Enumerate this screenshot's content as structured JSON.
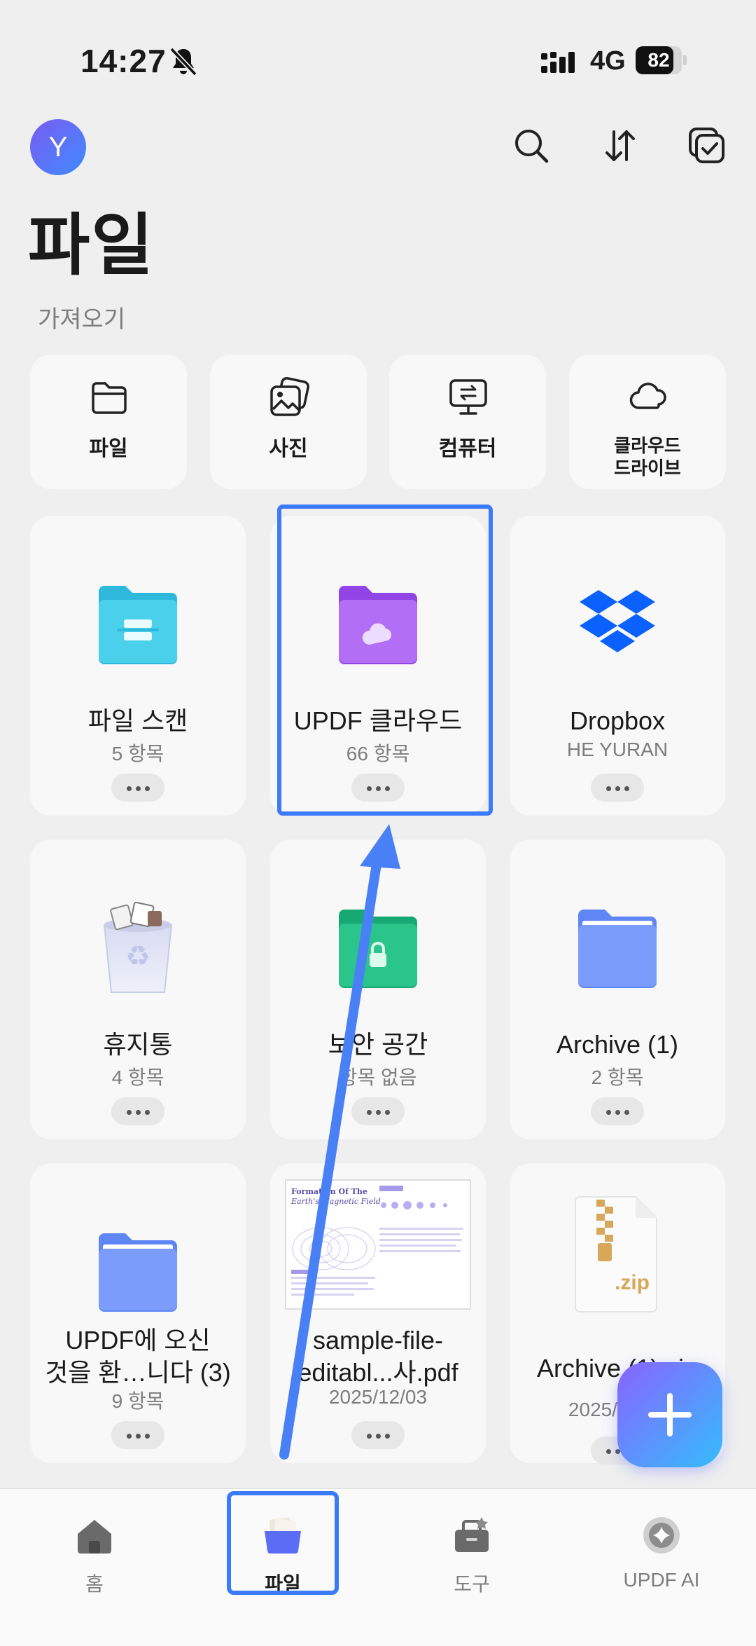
{
  "status_bar": {
    "time": "14:27",
    "network": "4G",
    "battery": "82",
    "battery_level": 0.82
  },
  "header": {
    "avatar_letter": "Y",
    "title": "파일"
  },
  "import": {
    "label": "가져오기",
    "items": [
      {
        "label": "파일",
        "icon": "folder-outline-icon"
      },
      {
        "label": "사진",
        "icon": "photos-icon"
      },
      {
        "label": "컴퓨터",
        "icon": "computer-transfer-icon"
      },
      {
        "label_line1": "클라우드",
        "label_line2": "드라이브",
        "icon": "cloud-icon"
      }
    ]
  },
  "cards": [
    {
      "name": "파일 스캔",
      "meta": "5 항목",
      "icon": "scan-folder-icon"
    },
    {
      "name": "UPDF 클라우드",
      "meta": "66 항목",
      "icon": "cloud-folder-icon"
    },
    {
      "name": "Dropbox",
      "meta": "HE YURAN",
      "icon": "dropbox-icon"
    },
    {
      "name": "휴지통",
      "meta": "4 항목",
      "icon": "trash-icon"
    },
    {
      "name": "보안 공간",
      "meta": "항목 없음",
      "icon": "secure-folder-icon"
    },
    {
      "name": "Archive (1)",
      "meta": "2 항목",
      "icon": "folder-icon"
    },
    {
      "name_line1": "UPDF에 오신",
      "name_line2": "것을 환…니다 (3)",
      "meta": "9 항목",
      "icon": "folder-icon"
    },
    {
      "name_line1": "sample-file-",
      "name_line2": "editabl...사.pdf",
      "meta": "2025/12/03",
      "icon": "pdf-thumbnail",
      "pdf_title": "Formation Of The Earth's Magnetic Field"
    },
    {
      "name": "Archive (1).zip",
      "meta": "2025/12/03",
      "icon": "zip-icon"
    }
  ],
  "nav": [
    {
      "label": "홈",
      "icon": "home-icon"
    },
    {
      "label": "파일",
      "icon": "files-icon",
      "active": true
    },
    {
      "label": "도구",
      "icon": "tools-icon"
    },
    {
      "label": "UPDF AI",
      "icon": "ai-icon"
    }
  ],
  "colors": {
    "accent": "#3b7bfb",
    "teal_folder": "#3cc4e3",
    "purple_folder": "#a45cf0",
    "green_folder": "#2bc48a",
    "blue_folder": "#7b9cfb"
  }
}
